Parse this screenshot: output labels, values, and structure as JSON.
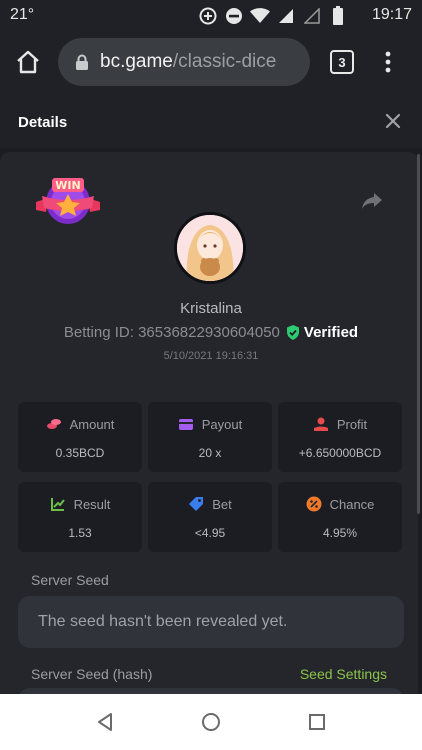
{
  "statusbar": {
    "temperature": "21°",
    "time": "19:17"
  },
  "browser": {
    "url_host": "bc.game",
    "url_path": "/classic-dice",
    "tab_count": "3"
  },
  "details": {
    "title": "Details",
    "win_badge_text": "WIN",
    "username": "Kristalina",
    "betting_id": "Betting ID: 365368229306040​50",
    "verified_label": "Verified",
    "timestamp": "5/10/2021 19:16:31",
    "stats": [
      {
        "label": "Amount",
        "value": "0.35BCD",
        "icon": "coins-icon",
        "color": "#e84b6a"
      },
      {
        "label": "Payout",
        "value": "20 x",
        "icon": "wallet-icon",
        "color": "#a55cf0"
      },
      {
        "label": "Profit",
        "value": "+6.650000BCD",
        "icon": "profit-hand-icon",
        "color": "#e84b4b"
      },
      {
        "label": "Result",
        "value": "1.53",
        "icon": "result-chart-icon",
        "color": "#6cc04a"
      },
      {
        "label": "Bet",
        "value": "<4.95",
        "icon": "bet-tag-icon",
        "color": "#3a7df0"
      },
      {
        "label": "Chance",
        "value": "4.95%",
        "icon": "percent-icon",
        "color": "#f07a2a"
      }
    ],
    "server_seed_label": "Server Seed",
    "server_seed_value": "The seed hasn't been revealed yet.",
    "server_seed_hash_label": "Server Seed (hash)",
    "seed_settings_label": "Seed Settings"
  },
  "colors": {
    "verified_green": "#2ecc71",
    "seed_settings_green": "#8bc34a"
  }
}
